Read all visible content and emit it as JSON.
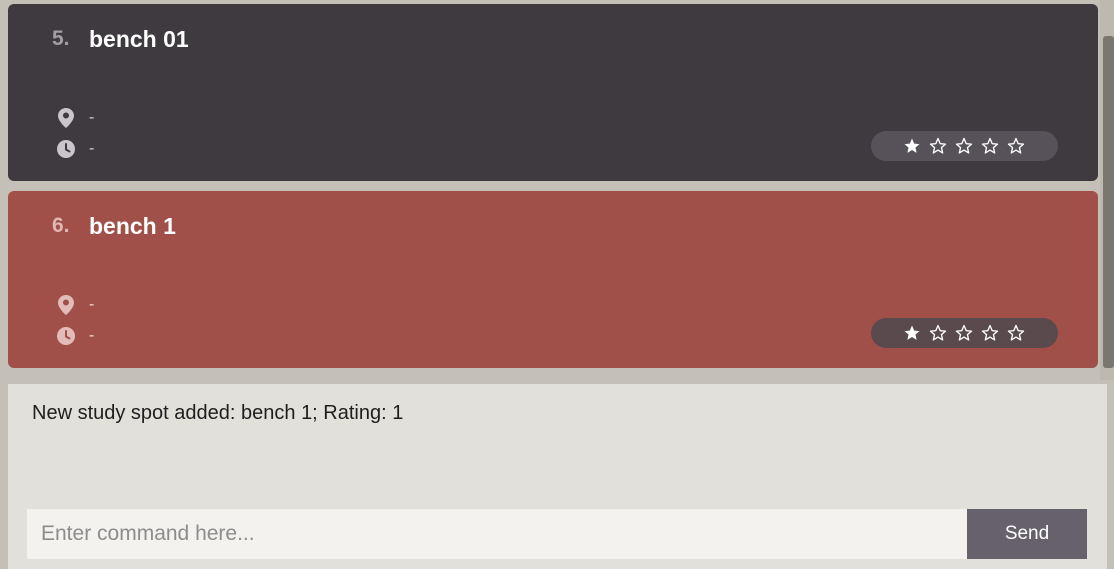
{
  "spots": [
    {
      "index": "5.",
      "name": "bench 01",
      "location": "-",
      "time": "-",
      "rating": 1,
      "rating_max": 5,
      "card_color": "#3e3a40"
    },
    {
      "index": "6.",
      "name": "bench 1",
      "location": "-",
      "time": "-",
      "rating": 1,
      "rating_max": 5,
      "card_color": "#a05048"
    }
  ],
  "console": {
    "feedback": "New study spot added: bench 1; Rating: 1",
    "placeholder": "Enter command here...",
    "value": "",
    "send_label": "Send"
  },
  "icons": {
    "location": "map-pin-icon",
    "time": "clock-icon",
    "star_filled": "star-filled-icon",
    "star_empty": "star-outline-icon"
  },
  "colors": {
    "background": "#c4c0b8",
    "selected_card": "#a05048",
    "default_card": "#3e3a40",
    "send_button": "#66616b"
  }
}
